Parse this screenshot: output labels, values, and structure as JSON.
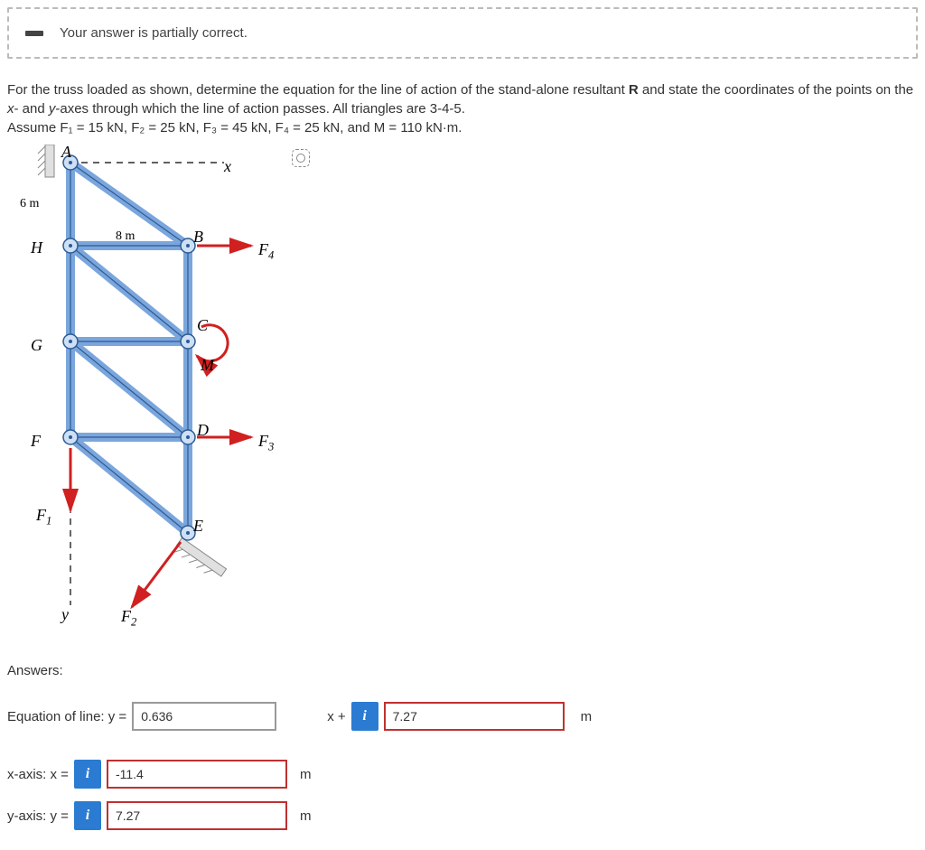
{
  "alert": {
    "text": "Your answer is partially correct."
  },
  "problem": {
    "line1_a": "For the truss loaded as shown, determine the equation for the line of action of the stand-alone resultant ",
    "line1_b": "R",
    "line1_c": " and state the coordinates of the points on the ",
    "line1_d": "x",
    "line1_e": "- and ",
    "line1_f": "y",
    "line1_g": "-axes through which the line of action passes. All triangles are 3-4-5.",
    "line2": "Assume F₁ = 15 kN, F₂ = 25 kN, F₃ = 45 kN, F₄ = 25 kN, and M = 110 kN·m."
  },
  "figure": {
    "A": "A",
    "B": "B",
    "C": "C",
    "D": "D",
    "E": "E",
    "F": "F",
    "G": "G",
    "H": "H",
    "dim6m": "6 m",
    "dim8m": "8 m",
    "x": "x",
    "y": "y",
    "M": "M",
    "F1": "F",
    "F1s": "1",
    "F2": "F",
    "F2s": "2",
    "F3": "F",
    "F3s": "3",
    "F4": "F",
    "F4s": "4"
  },
  "answers": {
    "heading": "Answers:",
    "eq_label": "Equation of line: y =",
    "slope": "0.636",
    "mid": "x +",
    "intercept": "7.27",
    "unit_m": "m",
    "xaxis_label": "x-axis: x =",
    "xaxis_val": "-11.4",
    "yaxis_label": "y-axis: y =",
    "yaxis_val": "7.27",
    "info": "i"
  }
}
